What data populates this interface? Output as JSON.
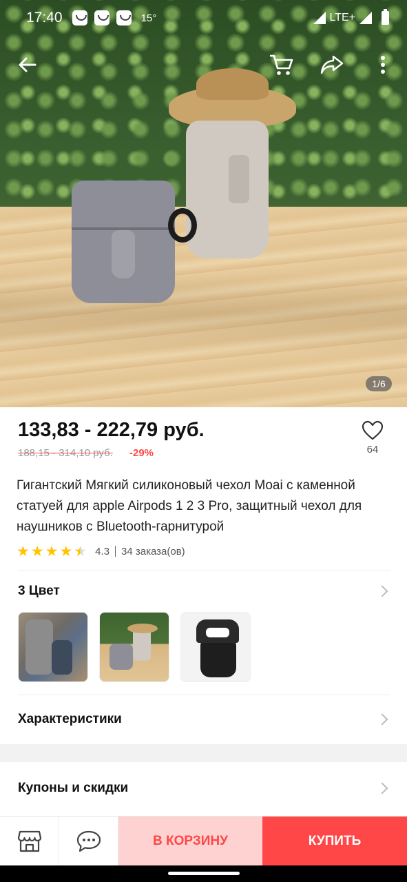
{
  "status_bar": {
    "time": "17:40",
    "temperature": "15°",
    "network": "LTE+"
  },
  "hero": {
    "counter": "1/6"
  },
  "product": {
    "price": "133,83 - 222,79 руб.",
    "old_price": "188,15 - 314,10 руб.",
    "discount": "-29%",
    "favorites_count": "64",
    "title": "Гигантский Мягкий силиконовый чехол Moai с каменной статуей для apple Airpods 1 2 3 Pro, защитный чехол для наушников с Bluetooth-гарнитурой",
    "rating": {
      "value": "4.3",
      "stars": 4.3,
      "orders": "34 заказа(ов)"
    }
  },
  "sections": {
    "colors_label": "3 Цвет",
    "specs_label": "Характеристики",
    "coupons_label": "Купоны и скидки"
  },
  "bottom_bar": {
    "cart_label": "В КОРЗИНУ",
    "buy_label": "КУПИТЬ"
  },
  "colors": {
    "accent": "#ff4747",
    "accent_light": "#ffd2d2",
    "star": "#ffc300"
  }
}
